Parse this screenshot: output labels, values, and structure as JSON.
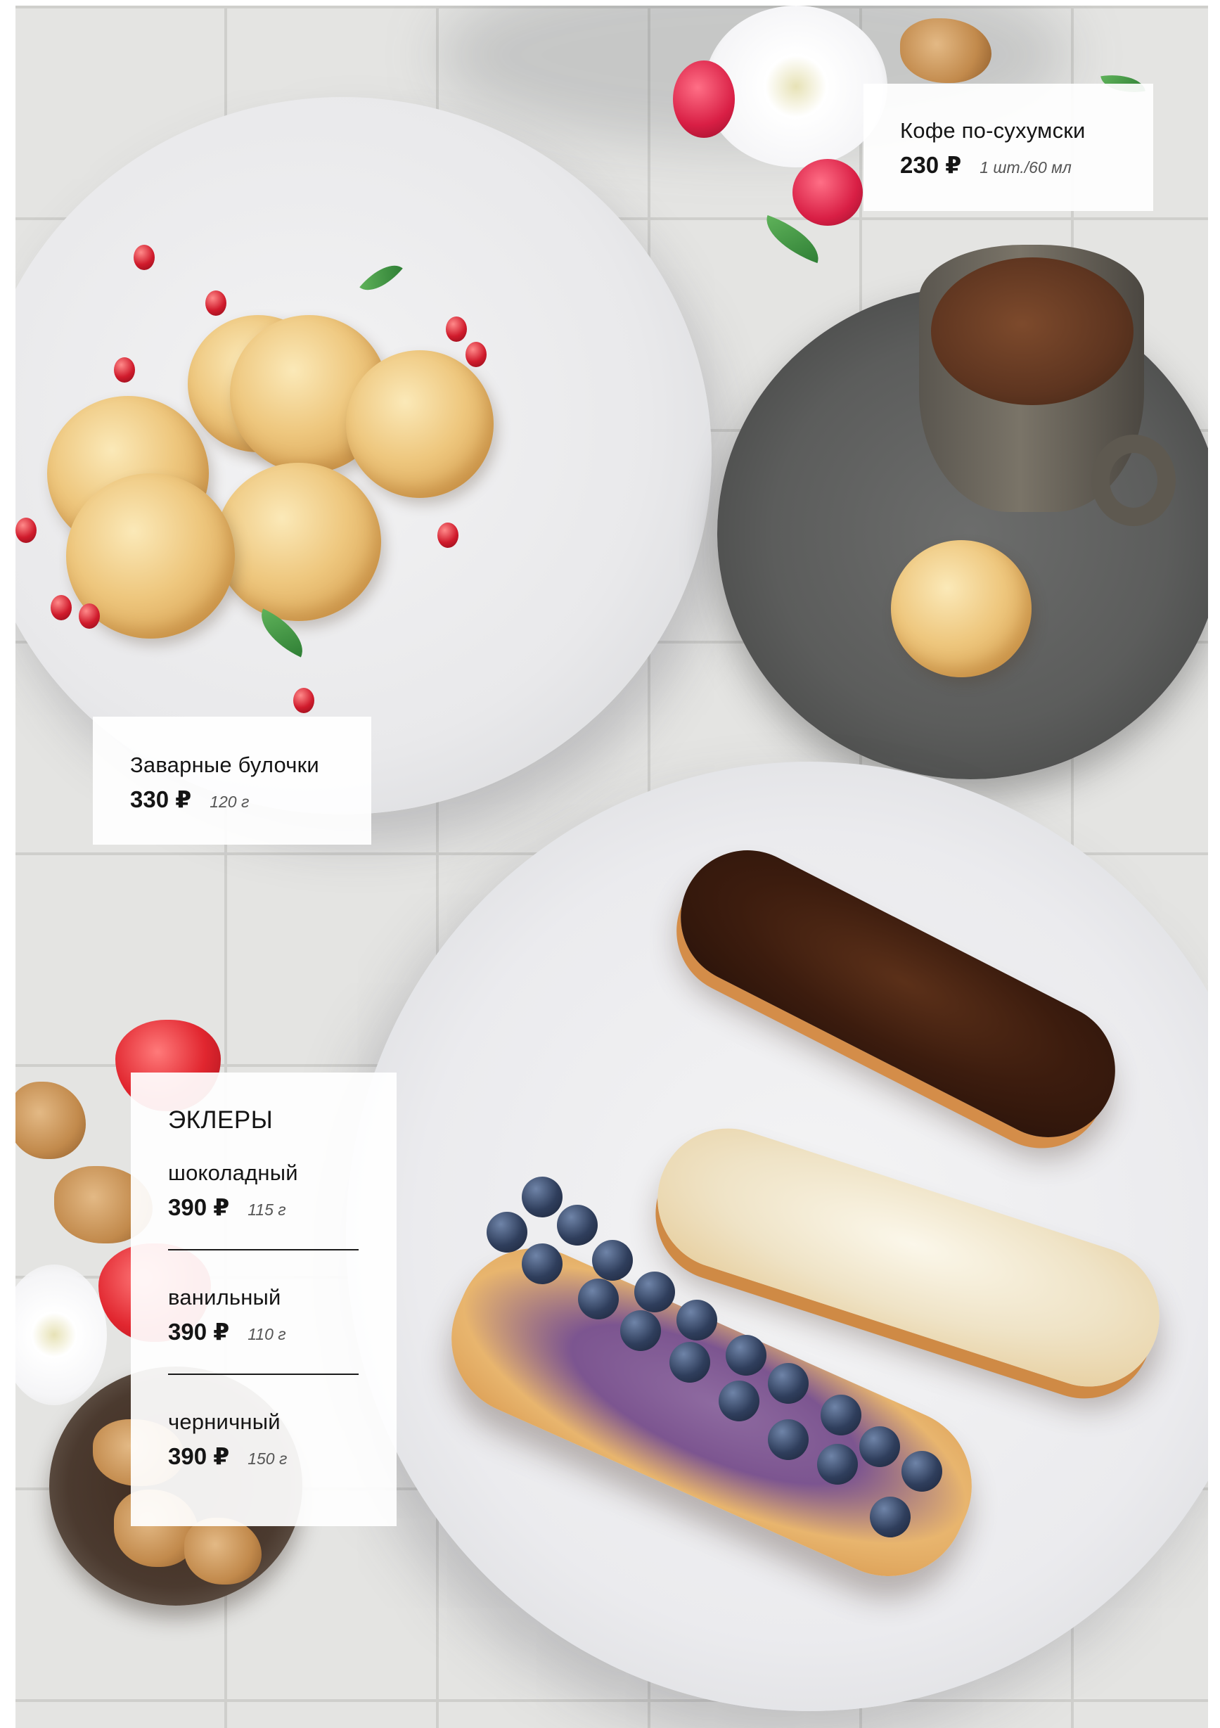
{
  "coffee": {
    "name": "Кофе по-сухумски",
    "price": "230 ₽",
    "weight": "1 шт./60 мл"
  },
  "buns": {
    "name": "Заварные булочки",
    "price": "330 ₽",
    "weight": "120 г"
  },
  "eclairs": {
    "title": "ЭКЛЕРЫ",
    "items": [
      {
        "name": "шоколадный",
        "price": "390 ₽",
        "weight": "115 г"
      },
      {
        "name": "ванильный",
        "price": "390 ₽",
        "weight": "110 г"
      },
      {
        "name": "черничный",
        "price": "390 ₽",
        "weight": "150 г"
      }
    ]
  }
}
